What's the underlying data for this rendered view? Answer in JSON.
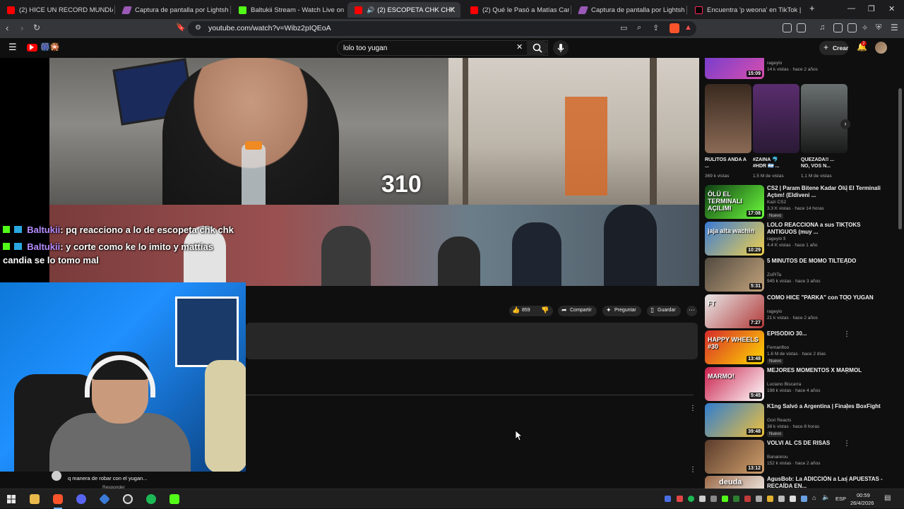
{
  "tabs": [
    {
      "label": "(2) HICE UN RECORD MUNDIAL EN",
      "color": "#ff0000"
    },
    {
      "label": "Captura de pantalla por Lightshot",
      "color": "#9b59b6"
    },
    {
      "label": "Baltukii Stream - Watch Live on Kick",
      "color": "#53fc18"
    },
    {
      "label": "(2) ESCOPETA CHK CHK",
      "color": "#ff0000"
    },
    {
      "label": "(2) Qué le Pasó a Matías Candia? - Yo",
      "color": "#ff0000"
    },
    {
      "label": "Captura de pantalla por Lightshot",
      "color": "#9b59b6"
    },
    {
      "label": "Encuentra 'p weona' en TikTok | Bus",
      "color": "#ffffff"
    }
  ],
  "address": {
    "url": "youtube.com/watch?v=Wibz2pIQEoA"
  },
  "youtube": {
    "search_value": "lolo too yugan",
    "create_label": "Crear",
    "notif_count": "2"
  },
  "overlay": {
    "counter": "310",
    "chat": [
      {
        "user": "Baltukii",
        "text": ": pq reacciono a lo de escopeta chk chk"
      },
      {
        "user": "Baltukii",
        "text": ": y corte como ke lo imito y mattias candia se lo tomo mal"
      }
    ]
  },
  "actions": {
    "likes": "859",
    "share": "Compartir",
    "ask": "Preguntar",
    "save": "Guardar"
  },
  "comment": {
    "text": "q manera de robar con el yugan...",
    "reply": "Responder"
  },
  "shorts": [
    {
      "title": "RULITOS ANDA A ...",
      "views": "369 k vistas"
    },
    {
      "title": "#ZAINA 🐬 #HDR 🇦🇷 ...",
      "views": "1.5 M de vistas"
    },
    {
      "title": "QUEZADA!! ... NO, VOS N...",
      "views": "1.1 M de vistas"
    }
  ],
  "top_partial": {
    "channel": "rageylo",
    "meta": "14 k vistas · hace 2 años",
    "duration": "15:09"
  },
  "recommendations": [
    {
      "title": "CS2 | Param Bitene Kadar Ölü El Terminali Açtım! (Eldiveni ...",
      "channel": "Kazi CS2",
      "meta": "3.3 K vistas · hace 14 horas",
      "badge": "Nuevo",
      "duration": "17:08",
      "c1": "#0f3d14",
      "c2": "#6cff3c"
    },
    {
      "title": "LOLO REACCIONA a sus TIKTOKS ANTIGUOS (muy ...",
      "channel": "rageylo fi",
      "meta": "4.4 K vistas · hace 1 año",
      "badge": "",
      "duration": "10:29",
      "c1": "#3a7bd5",
      "c2": "#f2d14b"
    },
    {
      "title": "5 MINUTOS DE MOMO TILTEADO",
      "channel": "ZoPiTa",
      "meta": "945 k vistas · hace 3 años",
      "badge": "",
      "duration": "5:31",
      "c1": "#514a40",
      "c2": "#c2a27b"
    },
    {
      "title": "COMO HICE \"PARKA\" con TOO YUGAN",
      "channel": "rageylo",
      "meta": "21 k vistas · hace 2 años",
      "badge": "",
      "duration": "7:27",
      "c1": "#e8e8e8",
      "c2": "#b23a3a"
    },
    {
      "title": "EPISODIO 30...",
      "channel": "Fernanfloo",
      "meta": "1.6 M de vistas · hace 2 días",
      "badge": "Nuevo",
      "duration": "13:48",
      "c1": "#d62b2b",
      "c2": "#ffd800"
    },
    {
      "title": "MEJORES MOMENTOS X MARMOL",
      "channel": "Luciano Biscarra",
      "meta": "198 k vistas · hace 4 años",
      "badge": "",
      "duration": "5:45",
      "c1": "#c81f4b",
      "c2": "#ffffff"
    },
    {
      "title": "K1ng Salvó a Argentina | Finales BoxFight",
      "channel": "Gori Reacts",
      "meta": "38 k vistas · hace 8 horas",
      "badge": "Nuevo",
      "duration": "39:48",
      "c1": "#2f7dd1",
      "c2": "#f0c03a"
    },
    {
      "title": "VOLVI AL CS DE RISAS",
      "channel": "Bananirou",
      "meta": "152 k vistas · hace 2 años",
      "badge": "",
      "duration": "13:12",
      "c1": "#5a3c2c",
      "c2": "#d2a06c"
    },
    {
      "title": "AgusBob: La ADICCIÓN a Las APUESTAS - RECAÍDA EN...",
      "channel": "",
      "meta": "",
      "badge": "",
      "duration": "",
      "c1": "#9b6a48",
      "c2": "#ffffff"
    }
  ],
  "partial_bottom_thumb_text": "deuda",
  "rec_thumb_texts": [
    "ÖLÜ EL TERMINALI AÇILIMI",
    "jaja alta wachin",
    "",
    "FT",
    "HAPPY WHEELS #30",
    "MARMO!",
    "",
    "",
    ""
  ],
  "taskbar": {
    "lang": "ESP",
    "time": "00:59",
    "date": "26/4/2026"
  }
}
